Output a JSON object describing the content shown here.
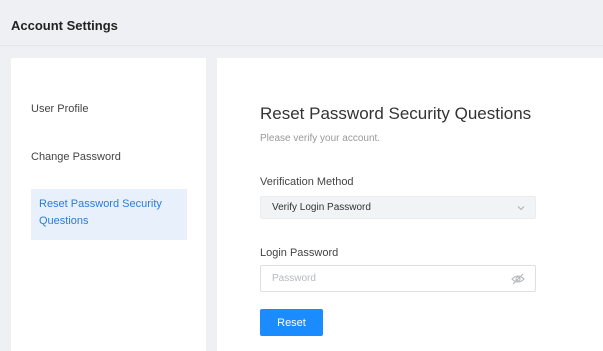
{
  "header": {
    "title": "Account Settings"
  },
  "sidebar": {
    "items": [
      {
        "label": "User Profile"
      },
      {
        "label": "Change Password"
      },
      {
        "label": "Reset Password Security Questions",
        "active": true
      }
    ]
  },
  "main": {
    "title": "Reset Password Security Questions",
    "subtitle": "Please verify your account.",
    "verification": {
      "label": "Verification Method",
      "selected": "Verify Login Password"
    },
    "password": {
      "label": "Login Password",
      "placeholder": "Password",
      "value": ""
    },
    "reset_label": "Reset"
  },
  "colors": {
    "accent": "#1a8cff",
    "active_bg": "#e8f1fb",
    "active_text": "#2b7bd8"
  },
  "icons": {
    "select_chevron": "chevron-down-icon",
    "password_toggle": "eye-off-icon"
  }
}
